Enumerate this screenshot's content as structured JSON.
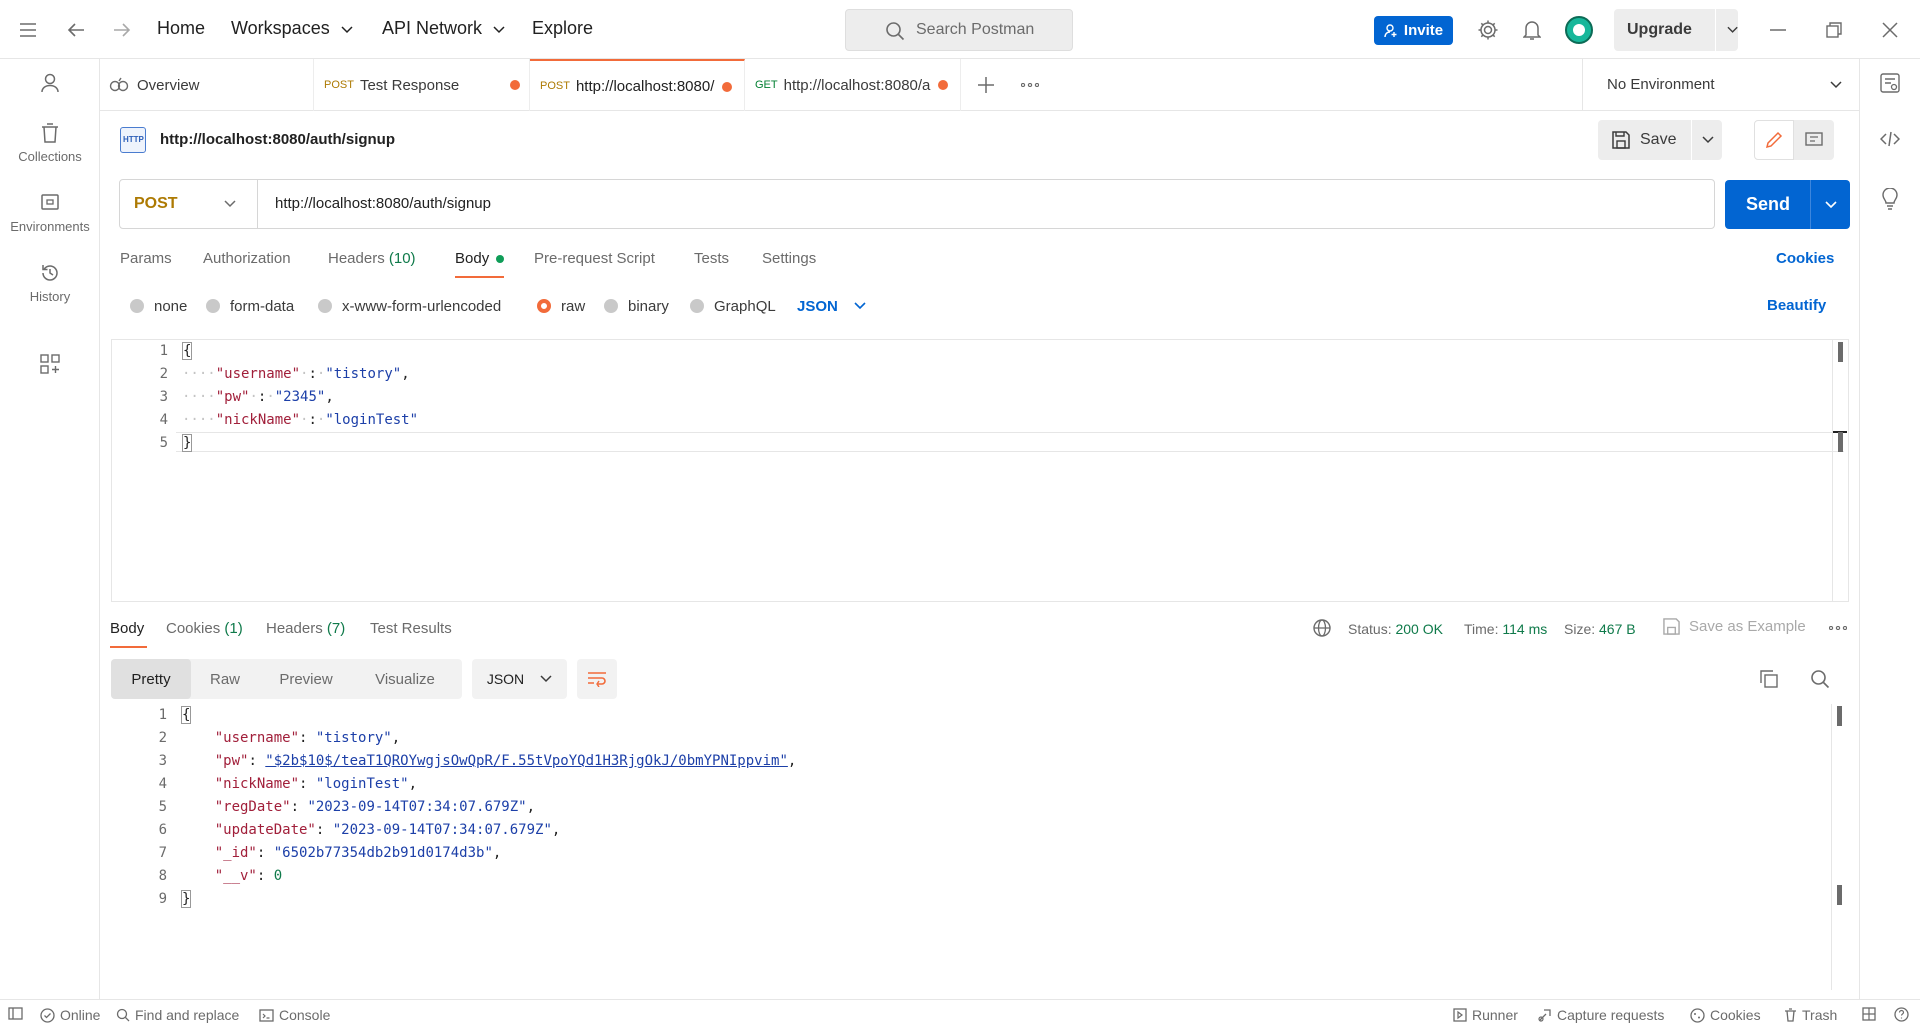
{
  "nav": {
    "home": "Home",
    "workspaces": "Workspaces",
    "api_network": "API Network",
    "explore": "Explore",
    "search_placeholder": "Search Postman",
    "invite": "Invite",
    "upgrade": "Upgrade"
  },
  "sidebar": {
    "items": [
      {
        "label": "Collections",
        "icon": "collections-icon"
      },
      {
        "label": "Environments",
        "icon": "environments-icon"
      },
      {
        "label": "History",
        "icon": "history-icon"
      }
    ]
  },
  "tabs": [
    {
      "method": "",
      "label": "Overview"
    },
    {
      "method": "POST",
      "label": "Test Response"
    },
    {
      "method": "POST",
      "label": "http://localhost:8080/"
    },
    {
      "method": "GET",
      "label": "http://localhost:8080/a"
    }
  ],
  "environment": "No Environment",
  "request": {
    "badge": "HTTP",
    "title": "http://localhost:8080/auth/signup",
    "save": "Save",
    "method": "POST",
    "url": "http://localhost:8080/auth/signup",
    "send": "Send",
    "tabs": {
      "params": "Params",
      "authorization": "Authorization",
      "headers": "Headers",
      "headers_count": "(10)",
      "body": "Body",
      "prerequest": "Pre-request Script",
      "tests": "Tests",
      "settings": "Settings",
      "cookies": "Cookies"
    },
    "body_types": {
      "none": "none",
      "formdata": "form-data",
      "urlencoded": "x-www-form-urlencoded",
      "raw": "raw",
      "binary": "binary",
      "graphql": "GraphQL",
      "format": "JSON",
      "beautify": "Beautify"
    },
    "body_lines": {
      "l1": "1",
      "l2": "2",
      "l3": "3",
      "l4": "4",
      "l5": "5",
      "k_username": "\"username\"",
      "v_username": "\"tistory\"",
      "k_pw": "\"pw\"",
      "v_pw": "\"2345\"",
      "k_nick": "\"nickName\"",
      "v_nick": "\"loginTest\"",
      "open": "{",
      "close": "}"
    }
  },
  "response": {
    "tabs": {
      "body": "Body",
      "cookies": "Cookies",
      "cookies_count": "(1)",
      "headers": "Headers",
      "headers_count": "(7)",
      "test_results": "Test Results"
    },
    "status_label": "Status:",
    "status": "200 OK",
    "time_label": "Time:",
    "time": "114 ms",
    "size_label": "Size:",
    "size": "467 B",
    "save_example": "Save as Example",
    "views": {
      "pretty": "Pretty",
      "raw": "Raw",
      "preview": "Preview",
      "visualize": "Visualize",
      "format": "JSON"
    },
    "lines": {
      "l1": "1",
      "l2": "2",
      "l3": "3",
      "l4": "4",
      "l5": "5",
      "l6": "6",
      "l7": "7",
      "l8": "8",
      "l9": "9",
      "open": "{",
      "close": "}",
      "k_username": "\"username\"",
      "v_username": "\"tistory\"",
      "k_pw": "\"pw\"",
      "v_pw": "\"$2b$10$/teaT1QROYwgjsOwQpR/F.55tVpoYQd1H3RjgOkJ/0bmYPNIppvim\"",
      "k_nick": "\"nickName\"",
      "v_nick": "\"loginTest\"",
      "k_reg": "\"regDate\"",
      "v_reg": "\"2023-09-14T07:34:07.679Z\"",
      "k_upd": "\"updateDate\"",
      "v_upd": "\"2023-09-14T07:34:07.679Z\"",
      "k_id": "\"_id\"",
      "v_id": "\"6502b77354db2b91d0174d3b\"",
      "k_v": "\"__v\"",
      "v_v": "0"
    }
  },
  "footer": {
    "online": "Online",
    "find_replace": "Find and replace",
    "console": "Console",
    "runner": "Runner",
    "capture": "Capture requests",
    "cookies": "Cookies",
    "trash": "Trash"
  },
  "colors": {
    "accent": "#0265d2",
    "orange": "#f26b3a",
    "post": "#ad7a03",
    "get": "#007f31",
    "status_green": "#0f7a4a"
  }
}
